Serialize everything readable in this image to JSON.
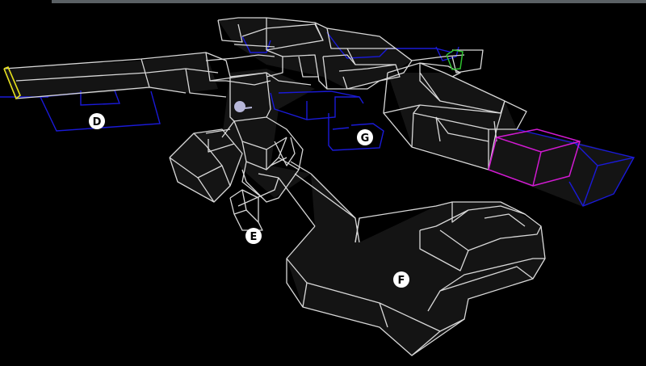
{
  "viewport": {
    "background": "#000000",
    "wire_color": "#d8d8d8",
    "room_fill": "#151515"
  },
  "colors": {
    "blue": "#1a1ad8",
    "magenta": "#d21ad2",
    "yellow": "#e6e01a",
    "green": "#2ec02e",
    "marker": "#ffffff"
  },
  "markers": {
    "d": {
      "label": "D"
    },
    "e": {
      "label": "E"
    },
    "f": {
      "label": "F"
    },
    "g": {
      "label": "G"
    }
  },
  "icons": {
    "entity": "sphere-icon"
  }
}
